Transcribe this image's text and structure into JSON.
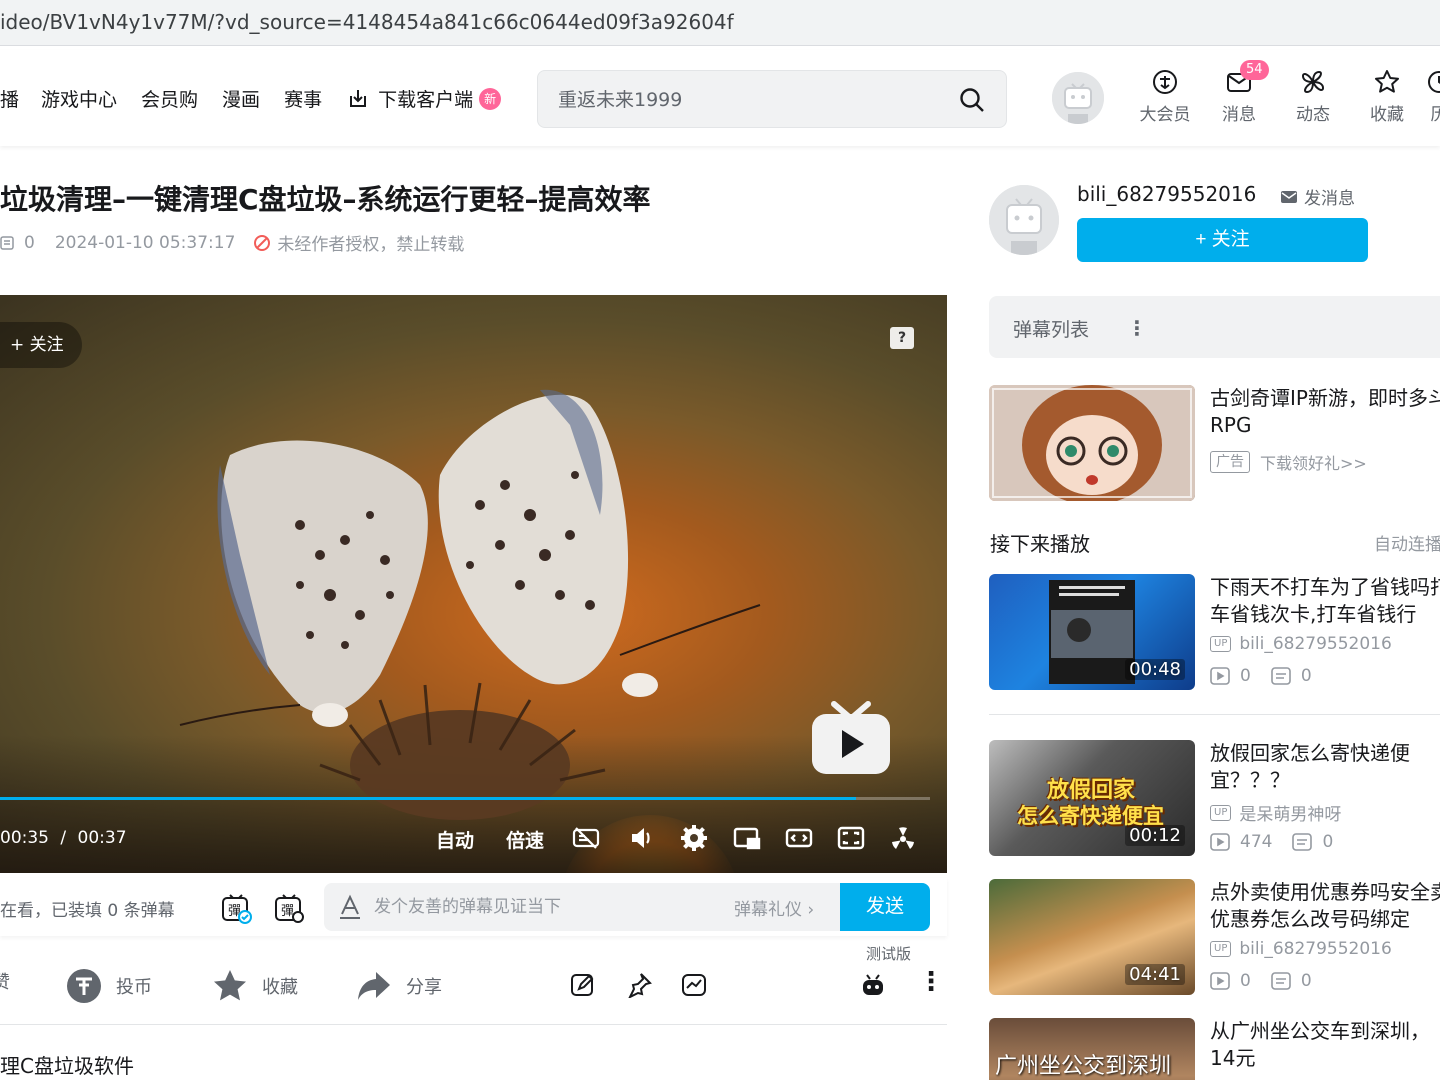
{
  "browser": {
    "url": "ideo/BV1vN4y1v77M/?vd_source=4148454a841c66c0644ed09f3a92604f"
  },
  "header": {
    "nav_items": [
      "播",
      "游戏中心",
      "会员购",
      "漫画",
      "赛事"
    ],
    "download_label": "下载客户端",
    "new_badge": "新",
    "search_placeholder": "重返未来1999",
    "right_items": [
      {
        "label": "大会员",
        "icon": "vip-icon"
      },
      {
        "label": "消息",
        "icon": "message-icon",
        "badge": "54"
      },
      {
        "label": "动态",
        "icon": "windmill-icon"
      },
      {
        "label": "收藏",
        "icon": "star-icon"
      },
      {
        "label": "历",
        "icon": "history-icon"
      }
    ]
  },
  "video": {
    "title": "垃圾清理–一键清理C盘垃圾–系统运行更轻–提高效率",
    "danmaku_count": "0",
    "date": "2024-01-10 05:37:17",
    "copyright": "未经作者授权，禁止转载",
    "description": "理C盘垃圾软件"
  },
  "player": {
    "follow_label": "关注",
    "help_label": "?",
    "current_time": "00:35",
    "separator": "/",
    "total_time": "00:37",
    "progress": 0.92,
    "auto_label": "自动",
    "speed_label": "倍速"
  },
  "danmaku_bar": {
    "watching_text": "在看，已装填 0 条弹幕",
    "input_placeholder": "发个友善的弹幕见证当下",
    "gift_label": "弹幕礼仪 ›",
    "send_label": "发送",
    "beta_label": "测试版"
  },
  "toolbar": {
    "like_label": "赞",
    "coin_label": "投币",
    "fav_label": "收藏",
    "share_label": "分享"
  },
  "up": {
    "name": "bili_68279552016",
    "message_label": "发消息",
    "follow_label": "+ 关注"
  },
  "sidebar": {
    "danmaku_list_label": "弹幕列表",
    "danmaku_list_more": "⋮",
    "ad": {
      "title": "古剑奇谭IP新游，即时多斗RPG",
      "tag": "广告",
      "link": "下载领好礼>>"
    },
    "next_label": "接下来播放",
    "autoplay_label": "自动连播",
    "recommendations": [
      {
        "title": "下雨天不打车为了省钱吗打车省钱次卡,打车省钱行",
        "author": "bili_68279552016",
        "plays": "0",
        "danmaku": "0",
        "duration": "00:48"
      },
      {
        "title": "放假回家怎么寄快递便宜？？？",
        "author": "是呆萌男神呀",
        "plays": "474",
        "danmaku": "0",
        "duration": "00:12",
        "overlay": "放假回家 怎么寄快递便宜"
      },
      {
        "title": "点外卖使用优惠券吗安全卖优惠券怎么改号码绑定",
        "author": "bili_68279552016",
        "plays": "0",
        "danmaku": "0",
        "duration": "04:41"
      },
      {
        "title": "从广州坐公交车到深圳，14元",
        "overlay": "广州坐公交到深圳"
      }
    ]
  },
  "colors": {
    "accent": "#00aeec",
    "pink": "#ff6699",
    "text_primary": "#18191c",
    "text_secondary": "#61666d",
    "text_muted": "#9499a0"
  }
}
